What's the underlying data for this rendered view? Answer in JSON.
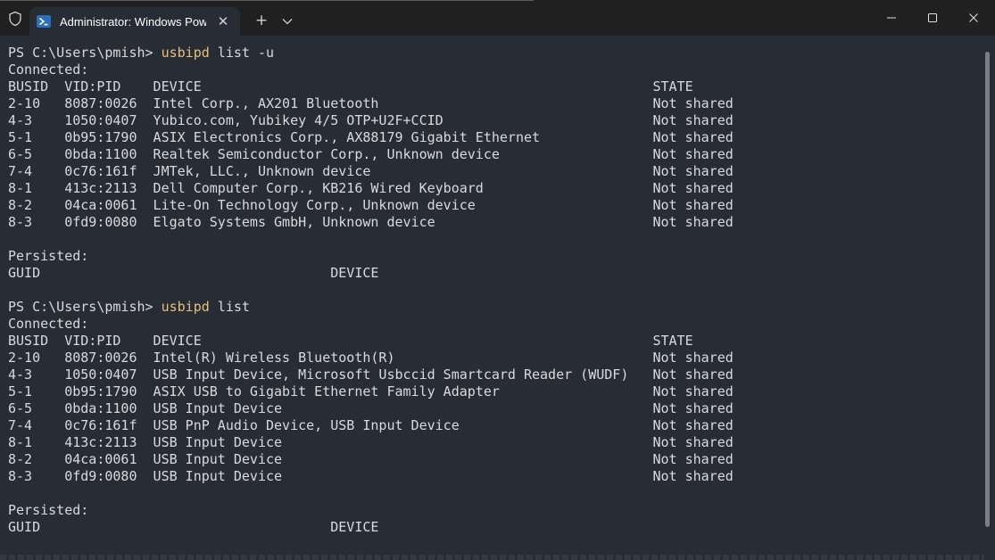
{
  "window": {
    "tab_title": "Administrator: Windows Powe",
    "new_tab_symbol": "+",
    "close_symbol": "✕"
  },
  "colors": {
    "terminal_bg": "#282c34",
    "titlebar_bg": "#202020",
    "text": "#d7dae0",
    "command": "#e5c07b"
  },
  "icons": {
    "shield": "shield-icon",
    "tab": "powershell-icon",
    "dropdown": "chevron-down-icon",
    "minimize": "minimize-icon",
    "maximize": "maximize-icon",
    "close": "close-icon"
  },
  "terminal": {
    "lines": [
      {
        "prompt": "PS C:\\Users\\pmish> ",
        "cmd": "usbipd",
        "args": " list -u"
      },
      {
        "text": "Connected:"
      },
      {
        "text": "BUSID  VID:PID    DEVICE                                                        STATE"
      },
      {
        "text": "2-10   8087:0026  Intel Corp., AX201 Bluetooth                                  Not shared"
      },
      {
        "text": "4-3    1050:0407  Yubico.com, Yubikey 4/5 OTP+U2F+CCID                          Not shared"
      },
      {
        "text": "5-1    0b95:1790  ASIX Electronics Corp., AX88179 Gigabit Ethernet              Not shared"
      },
      {
        "text": "6-5    0bda:1100  Realtek Semiconductor Corp., Unknown device                   Not shared"
      },
      {
        "text": "7-4    0c76:161f  JMTek, LLC., Unknown device                                   Not shared"
      },
      {
        "text": "8-1    413c:2113  Dell Computer Corp., KB216 Wired Keyboard                     Not shared"
      },
      {
        "text": "8-2    04ca:0061  Lite-On Technology Corp., Unknown device                      Not shared"
      },
      {
        "text": "8-3    0fd9:0080  Elgato Systems GmbH, Unknown device                           Not shared"
      },
      {
        "text": ""
      },
      {
        "text": "Persisted:"
      },
      {
        "text": "GUID                                    DEVICE"
      },
      {
        "text": ""
      },
      {
        "prompt": "PS C:\\Users\\pmish> ",
        "cmd": "usbipd",
        "args": " list"
      },
      {
        "text": "Connected:"
      },
      {
        "text": "BUSID  VID:PID    DEVICE                                                        STATE"
      },
      {
        "text": "2-10   8087:0026  Intel(R) Wireless Bluetooth(R)                                Not shared"
      },
      {
        "text": "4-3    1050:0407  USB Input Device, Microsoft Usbccid Smartcard Reader (WUDF)   Not shared"
      },
      {
        "text": "5-1    0b95:1790  ASIX USB to Gigabit Ethernet Family Adapter                   Not shared"
      },
      {
        "text": "6-5    0bda:1100  USB Input Device                                              Not shared"
      },
      {
        "text": "7-4    0c76:161f  USB PnP Audio Device, USB Input Device                        Not shared"
      },
      {
        "text": "8-1    413c:2113  USB Input Device                                              Not shared"
      },
      {
        "text": "8-2    04ca:0061  USB Input Device                                              Not shared"
      },
      {
        "text": "8-3    0fd9:0080  USB Input Device                                              Not shared"
      },
      {
        "text": ""
      },
      {
        "text": "Persisted:"
      },
      {
        "text": "GUID                                    DEVICE"
      }
    ]
  }
}
